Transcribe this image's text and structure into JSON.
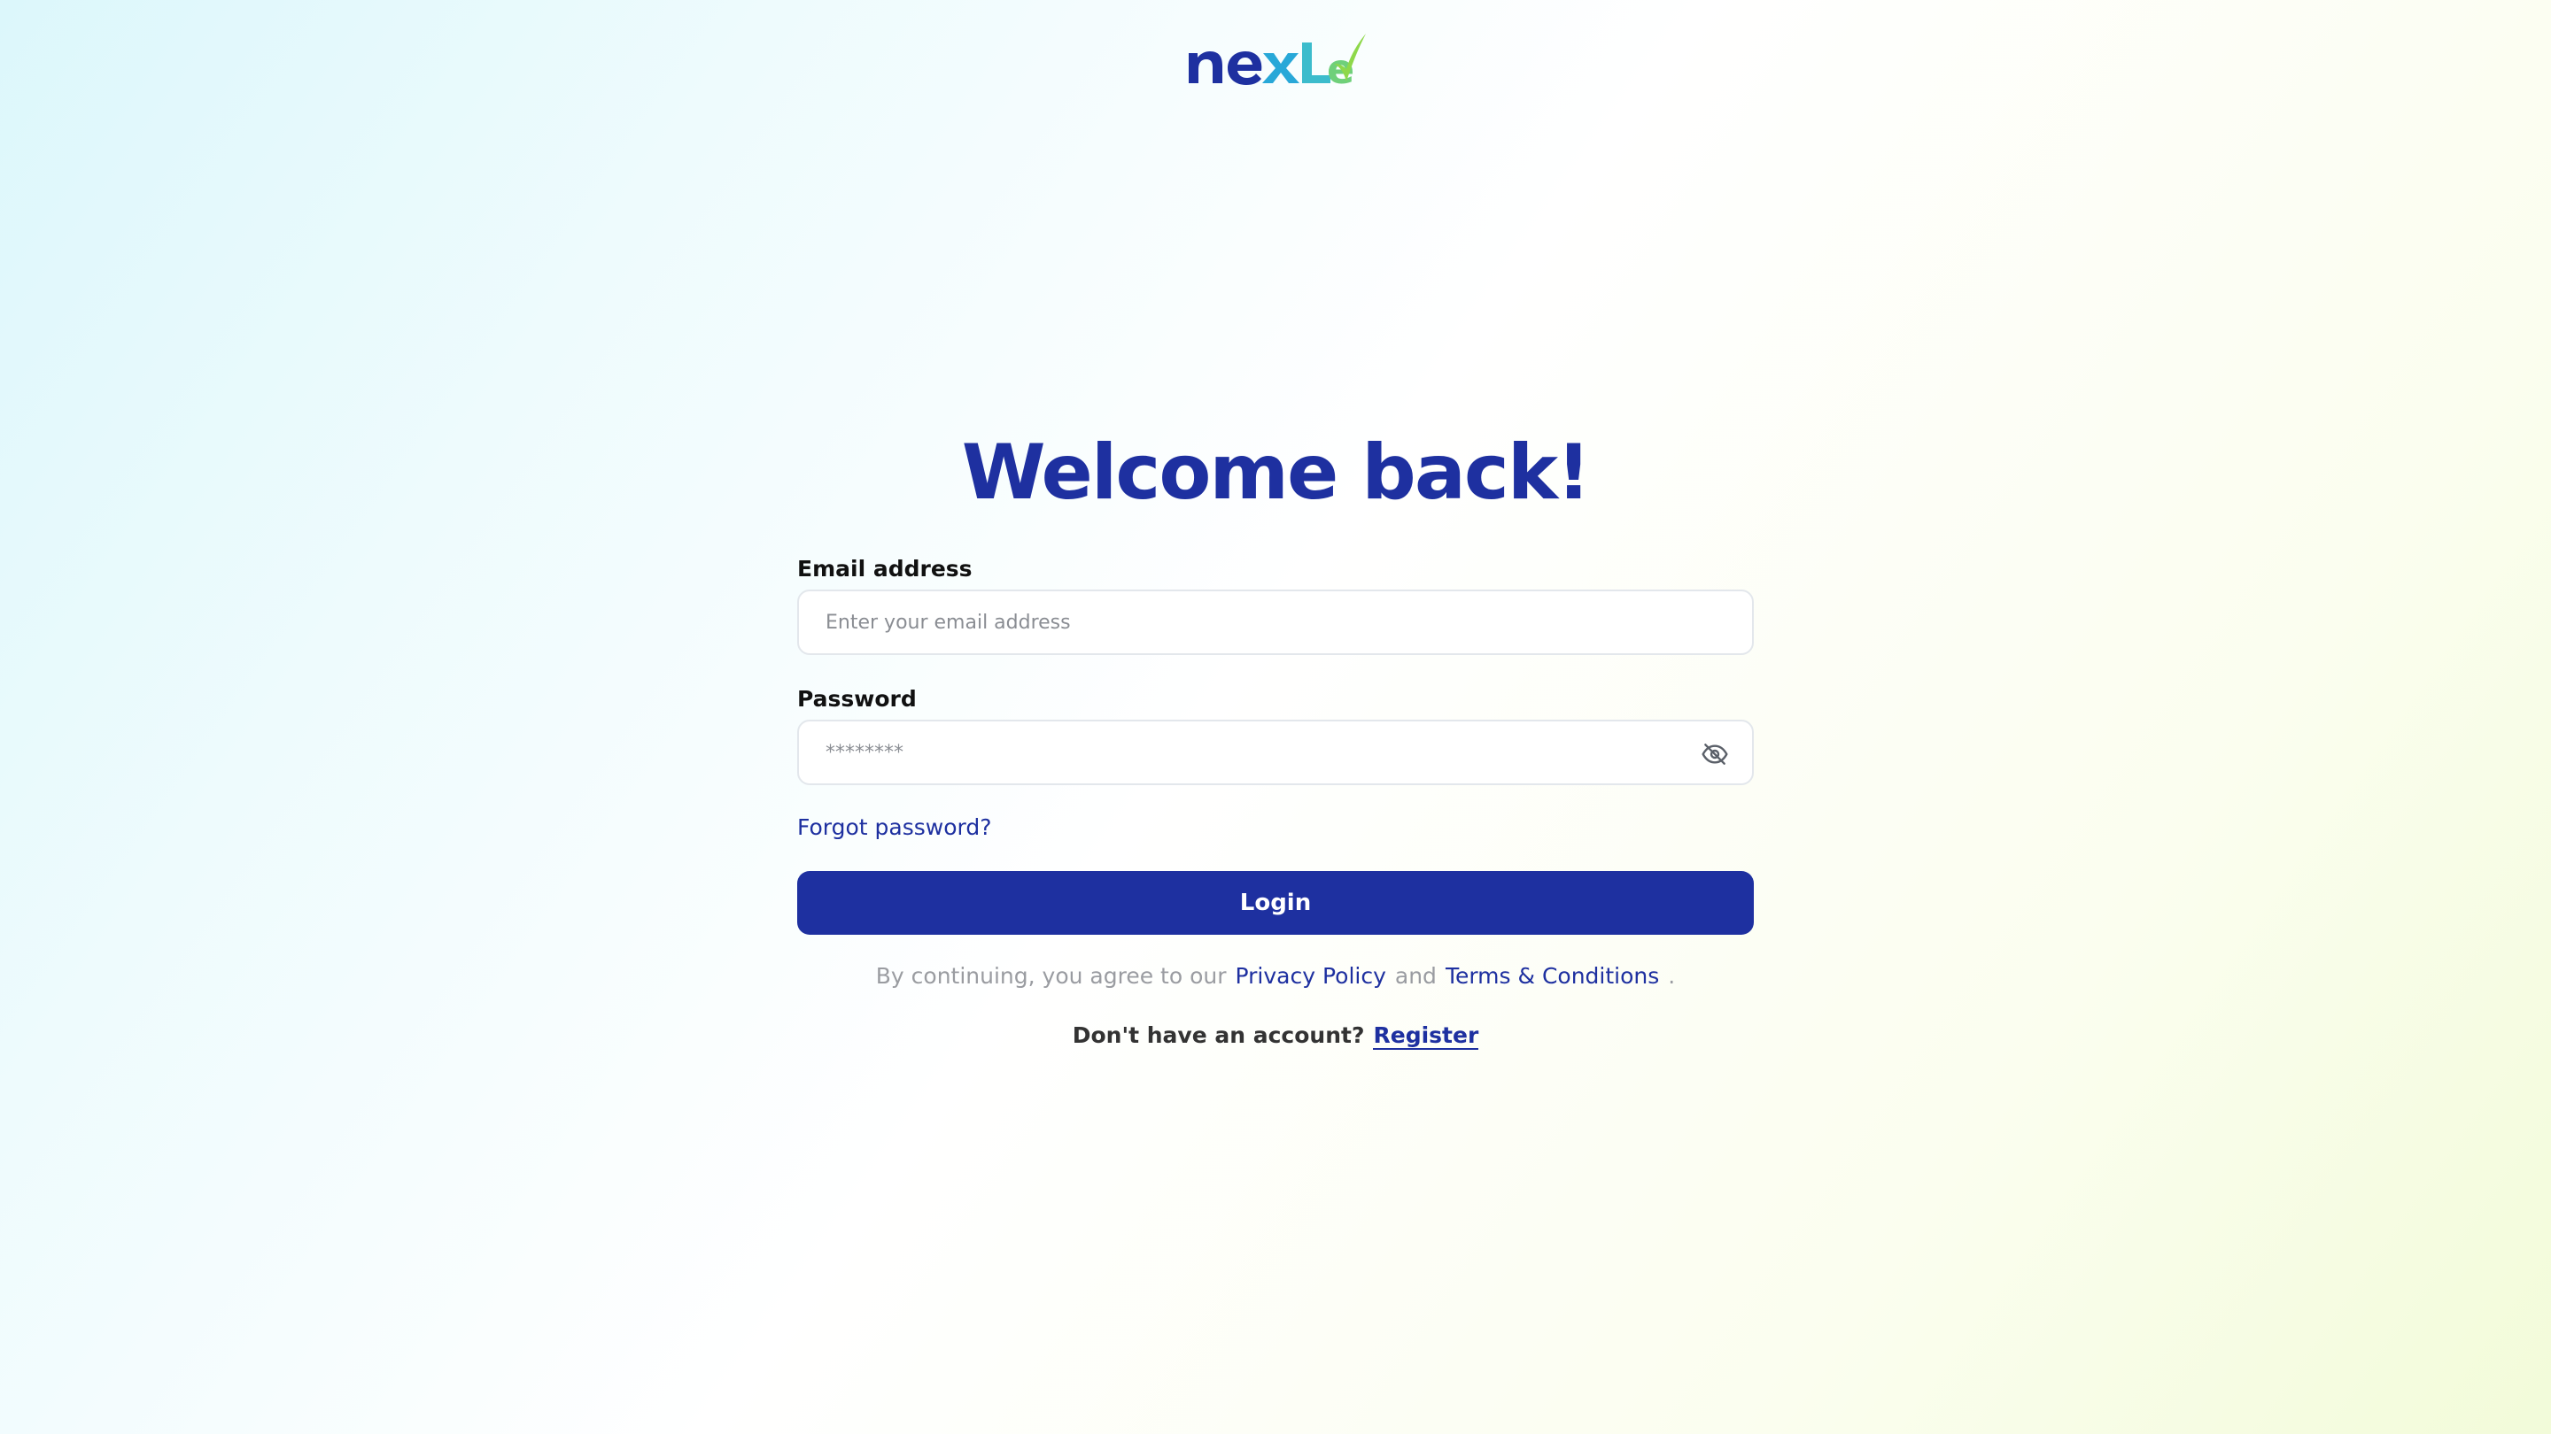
{
  "brand": {
    "logo_text": "nexle",
    "colors": {
      "primary": "#1e30a0",
      "logo_teal": "#28a8d8",
      "logo_green": "#8ed84a"
    }
  },
  "page": {
    "title": "Welcome back!"
  },
  "form": {
    "email": {
      "label": "Email address",
      "placeholder": "Enter your email address",
      "value": ""
    },
    "password": {
      "label": "Password",
      "placeholder": "********",
      "value": "",
      "toggle_icon": "eye-off-icon"
    },
    "forgot_password": "Forgot password?",
    "login_button": "Login"
  },
  "legal": {
    "prefix": "By continuing, you agree to our",
    "privacy_policy": "Privacy Policy",
    "and": "and",
    "terms": "Terms & Conditions",
    "suffix": "."
  },
  "signup": {
    "question": "Don't have an account?",
    "register": "Register"
  }
}
